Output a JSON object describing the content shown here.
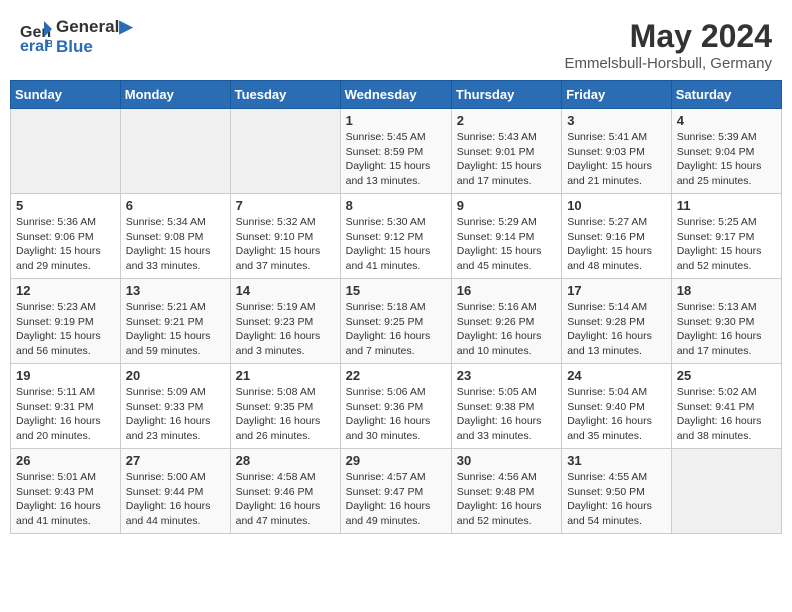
{
  "logo": {
    "general": "General",
    "blue": "Blue"
  },
  "title": "May 2024",
  "location": "Emmelsbull-Horsbull, Germany",
  "weekdays": [
    "Sunday",
    "Monday",
    "Tuesday",
    "Wednesday",
    "Thursday",
    "Friday",
    "Saturday"
  ],
  "weeks": [
    [
      {
        "day": "",
        "info": ""
      },
      {
        "day": "",
        "info": ""
      },
      {
        "day": "",
        "info": ""
      },
      {
        "day": "1",
        "info": "Sunrise: 5:45 AM\nSunset: 8:59 PM\nDaylight: 15 hours\nand 13 minutes."
      },
      {
        "day": "2",
        "info": "Sunrise: 5:43 AM\nSunset: 9:01 PM\nDaylight: 15 hours\nand 17 minutes."
      },
      {
        "day": "3",
        "info": "Sunrise: 5:41 AM\nSunset: 9:03 PM\nDaylight: 15 hours\nand 21 minutes."
      },
      {
        "day": "4",
        "info": "Sunrise: 5:39 AM\nSunset: 9:04 PM\nDaylight: 15 hours\nand 25 minutes."
      }
    ],
    [
      {
        "day": "5",
        "info": "Sunrise: 5:36 AM\nSunset: 9:06 PM\nDaylight: 15 hours\nand 29 minutes."
      },
      {
        "day": "6",
        "info": "Sunrise: 5:34 AM\nSunset: 9:08 PM\nDaylight: 15 hours\nand 33 minutes."
      },
      {
        "day": "7",
        "info": "Sunrise: 5:32 AM\nSunset: 9:10 PM\nDaylight: 15 hours\nand 37 minutes."
      },
      {
        "day": "8",
        "info": "Sunrise: 5:30 AM\nSunset: 9:12 PM\nDaylight: 15 hours\nand 41 minutes."
      },
      {
        "day": "9",
        "info": "Sunrise: 5:29 AM\nSunset: 9:14 PM\nDaylight: 15 hours\nand 45 minutes."
      },
      {
        "day": "10",
        "info": "Sunrise: 5:27 AM\nSunset: 9:16 PM\nDaylight: 15 hours\nand 48 minutes."
      },
      {
        "day": "11",
        "info": "Sunrise: 5:25 AM\nSunset: 9:17 PM\nDaylight: 15 hours\nand 52 minutes."
      }
    ],
    [
      {
        "day": "12",
        "info": "Sunrise: 5:23 AM\nSunset: 9:19 PM\nDaylight: 15 hours\nand 56 minutes."
      },
      {
        "day": "13",
        "info": "Sunrise: 5:21 AM\nSunset: 9:21 PM\nDaylight: 15 hours\nand 59 minutes."
      },
      {
        "day": "14",
        "info": "Sunrise: 5:19 AM\nSunset: 9:23 PM\nDaylight: 16 hours\nand 3 minutes."
      },
      {
        "day": "15",
        "info": "Sunrise: 5:18 AM\nSunset: 9:25 PM\nDaylight: 16 hours\nand 7 minutes."
      },
      {
        "day": "16",
        "info": "Sunrise: 5:16 AM\nSunset: 9:26 PM\nDaylight: 16 hours\nand 10 minutes."
      },
      {
        "day": "17",
        "info": "Sunrise: 5:14 AM\nSunset: 9:28 PM\nDaylight: 16 hours\nand 13 minutes."
      },
      {
        "day": "18",
        "info": "Sunrise: 5:13 AM\nSunset: 9:30 PM\nDaylight: 16 hours\nand 17 minutes."
      }
    ],
    [
      {
        "day": "19",
        "info": "Sunrise: 5:11 AM\nSunset: 9:31 PM\nDaylight: 16 hours\nand 20 minutes."
      },
      {
        "day": "20",
        "info": "Sunrise: 5:09 AM\nSunset: 9:33 PM\nDaylight: 16 hours\nand 23 minutes."
      },
      {
        "day": "21",
        "info": "Sunrise: 5:08 AM\nSunset: 9:35 PM\nDaylight: 16 hours\nand 26 minutes."
      },
      {
        "day": "22",
        "info": "Sunrise: 5:06 AM\nSunset: 9:36 PM\nDaylight: 16 hours\nand 30 minutes."
      },
      {
        "day": "23",
        "info": "Sunrise: 5:05 AM\nSunset: 9:38 PM\nDaylight: 16 hours\nand 33 minutes."
      },
      {
        "day": "24",
        "info": "Sunrise: 5:04 AM\nSunset: 9:40 PM\nDaylight: 16 hours\nand 35 minutes."
      },
      {
        "day": "25",
        "info": "Sunrise: 5:02 AM\nSunset: 9:41 PM\nDaylight: 16 hours\nand 38 minutes."
      }
    ],
    [
      {
        "day": "26",
        "info": "Sunrise: 5:01 AM\nSunset: 9:43 PM\nDaylight: 16 hours\nand 41 minutes."
      },
      {
        "day": "27",
        "info": "Sunrise: 5:00 AM\nSunset: 9:44 PM\nDaylight: 16 hours\nand 44 minutes."
      },
      {
        "day": "28",
        "info": "Sunrise: 4:58 AM\nSunset: 9:46 PM\nDaylight: 16 hours\nand 47 minutes."
      },
      {
        "day": "29",
        "info": "Sunrise: 4:57 AM\nSunset: 9:47 PM\nDaylight: 16 hours\nand 49 minutes."
      },
      {
        "day": "30",
        "info": "Sunrise: 4:56 AM\nSunset: 9:48 PM\nDaylight: 16 hours\nand 52 minutes."
      },
      {
        "day": "31",
        "info": "Sunrise: 4:55 AM\nSunset: 9:50 PM\nDaylight: 16 hours\nand 54 minutes."
      },
      {
        "day": "",
        "info": ""
      }
    ]
  ]
}
